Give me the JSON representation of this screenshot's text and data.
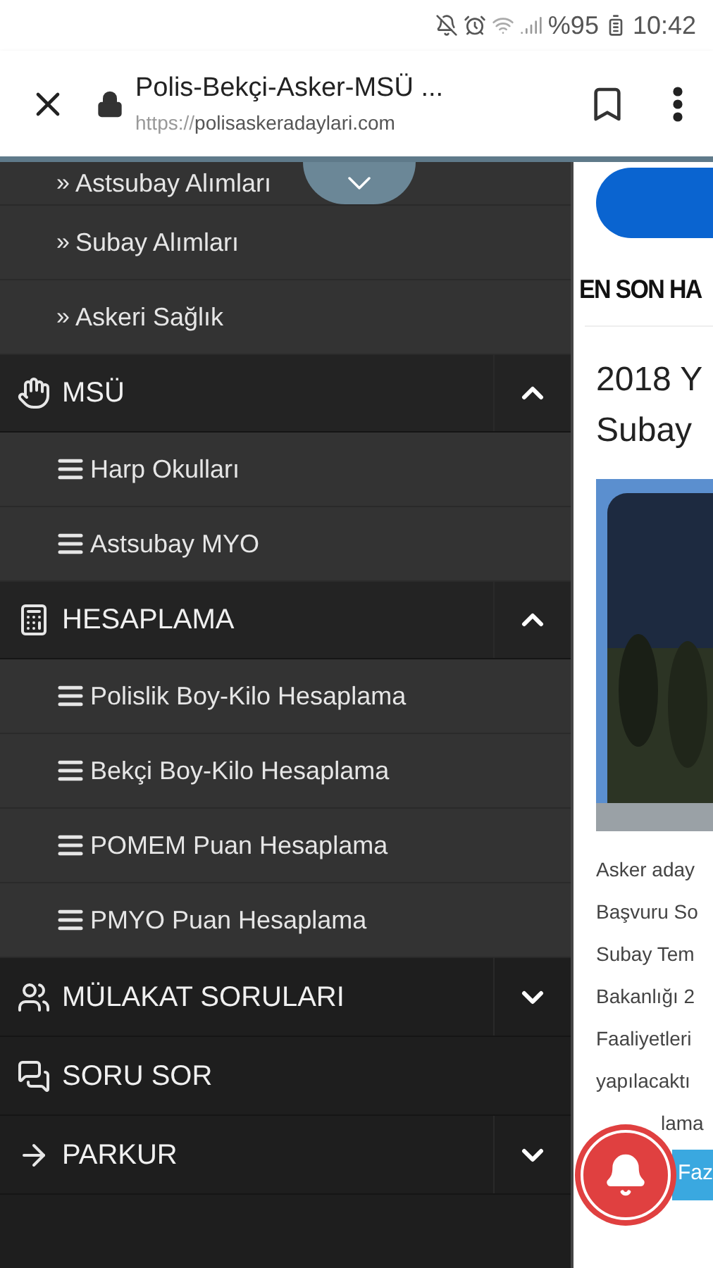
{
  "status_bar": {
    "battery": "%95",
    "time": "10:42"
  },
  "browser": {
    "title": "Polis-Bekçi-Asker-MSÜ ...",
    "url_scheme": "https://",
    "url_host": "polisaskeradaylari.com"
  },
  "menu": {
    "leading_items": [
      {
        "marker": "»",
        "label": "Astsubay Alımları"
      },
      {
        "marker": "»",
        "label": "Subay Alımları"
      },
      {
        "marker": "»",
        "label": "Askeri Sağlık"
      }
    ],
    "sections": [
      {
        "kind": "section",
        "label": "MSÜ",
        "expanded": true,
        "children": [
          {
            "label": "Harp Okulları"
          },
          {
            "label": "Astsubay MYO"
          }
        ]
      },
      {
        "kind": "section",
        "label": "HESAPLAMA",
        "expanded": true,
        "children": [
          {
            "label": "Polislik Boy-Kilo Hesaplama"
          },
          {
            "label": "Bekçi Boy-Kilo Hesaplama"
          },
          {
            "label": "POMEM Puan Hesaplama"
          },
          {
            "label": "PMYO Puan Hesaplama"
          }
        ]
      },
      {
        "kind": "section",
        "label": "MÜLAKAT SORULARI",
        "expanded": false
      },
      {
        "kind": "link",
        "label": "SORU SOR"
      },
      {
        "kind": "section",
        "label": "PARKUR",
        "expanded": false
      }
    ]
  },
  "content": {
    "heading": "EN SON HA",
    "post_title": [
      "2018 Y",
      "Subay"
    ],
    "image": {
      "kind": "picture"
    },
    "excerpt": [
      "Asker aday",
      "Başvuru So",
      "Subay Tem",
      "Bakanlığı 2",
      "Faaliyetleri",
      "yapılacaktı",
      "lama"
    ],
    "more_button": "Faz"
  }
}
